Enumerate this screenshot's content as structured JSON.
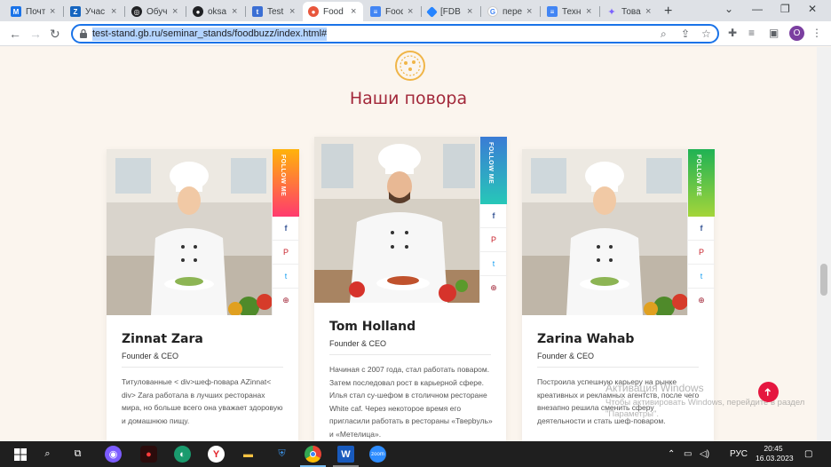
{
  "browser": {
    "tabs": [
      {
        "label": "Почт",
        "icon": "mail-icon",
        "color": "#1a73e8"
      },
      {
        "label": "Учас",
        "icon": "z-app-icon",
        "color": "#1565c0"
      },
      {
        "label": "Обуч",
        "icon": "chatgpt-icon",
        "color": "#202124"
      },
      {
        "label": "oksa",
        "icon": "github-icon",
        "color": "#202124"
      },
      {
        "label": "Test I",
        "icon": "testit-icon",
        "color": "#3b6fd4"
      },
      {
        "label": "Food",
        "icon": "foodbuzz-icon",
        "color": "#e8563c"
      },
      {
        "label": "Food",
        "icon": "docs-icon",
        "color": "#4285f4"
      },
      {
        "label": "[FDB",
        "icon": "jira-icon",
        "color": "#2684ff"
      },
      {
        "label": "пере",
        "icon": "google-icon",
        "color": "#4285f4"
      },
      {
        "label": "Техн",
        "icon": "docs-icon",
        "color": "#4285f4"
      },
      {
        "label": "Това",
        "icon": "sparkle-icon",
        "color": "#5f6368"
      }
    ],
    "new_tab": "+",
    "url": "test-stand.gb.ru/seminar_stands/foodbuzz/index.html#",
    "profile_initial": "O"
  },
  "section": {
    "title": "Наши повора"
  },
  "cards": [
    {
      "name": "Zinnat Zara",
      "role": "Founder & CEO",
      "follow": "FOLLOW ME",
      "follow_color_top": "#ffb30a",
      "follow_color_bottom": "#ff3a6e",
      "bio": "Титулованные < div>шеф-повара AZinnat< div> Zara работала в лучших ресторанах мира, но больше всего она уважает здоровую и домашнюю пищу."
    },
    {
      "name": "Tom Holland",
      "role": "Founder & CEO",
      "follow": "FOLLOW ME",
      "follow_color_top": "#3a7bd5",
      "follow_color_bottom": "#27c7b8",
      "bio": "Начиная с 2007 года, стал работать поваром. Затем последовал рост в карьерной сфере. Илья стал су-шефом в столичном ресторане White caf. Через некоторое время его пригласили работать в рестораны «Тверbуль» и «Метелица»."
    },
    {
      "name": "Zarina Wahab",
      "role": "Founder & CEO",
      "follow": "FOLLOW ME",
      "follow_color_top": "#1fb254",
      "follow_color_bottom": "#a4d53a",
      "bio": "Построила успешную карьеру на рынке креативных и рекламных агентств, после чего внезапно решила сменить сферу деятельности и стать шеф-повaром."
    }
  ],
  "social_labels": {
    "facebook": "f",
    "pinterest": "P",
    "twitter": "t",
    "website": "⊕"
  },
  "windows_watermark": {
    "title": "Активация Windows",
    "subtitle": "Чтобы активировать Windows, перейдите в раздел \"Параметры\"."
  },
  "back_to_top": "➜",
  "taskbar": {
    "language": "РУС",
    "time": "20:45",
    "date": "16.03.2023"
  }
}
